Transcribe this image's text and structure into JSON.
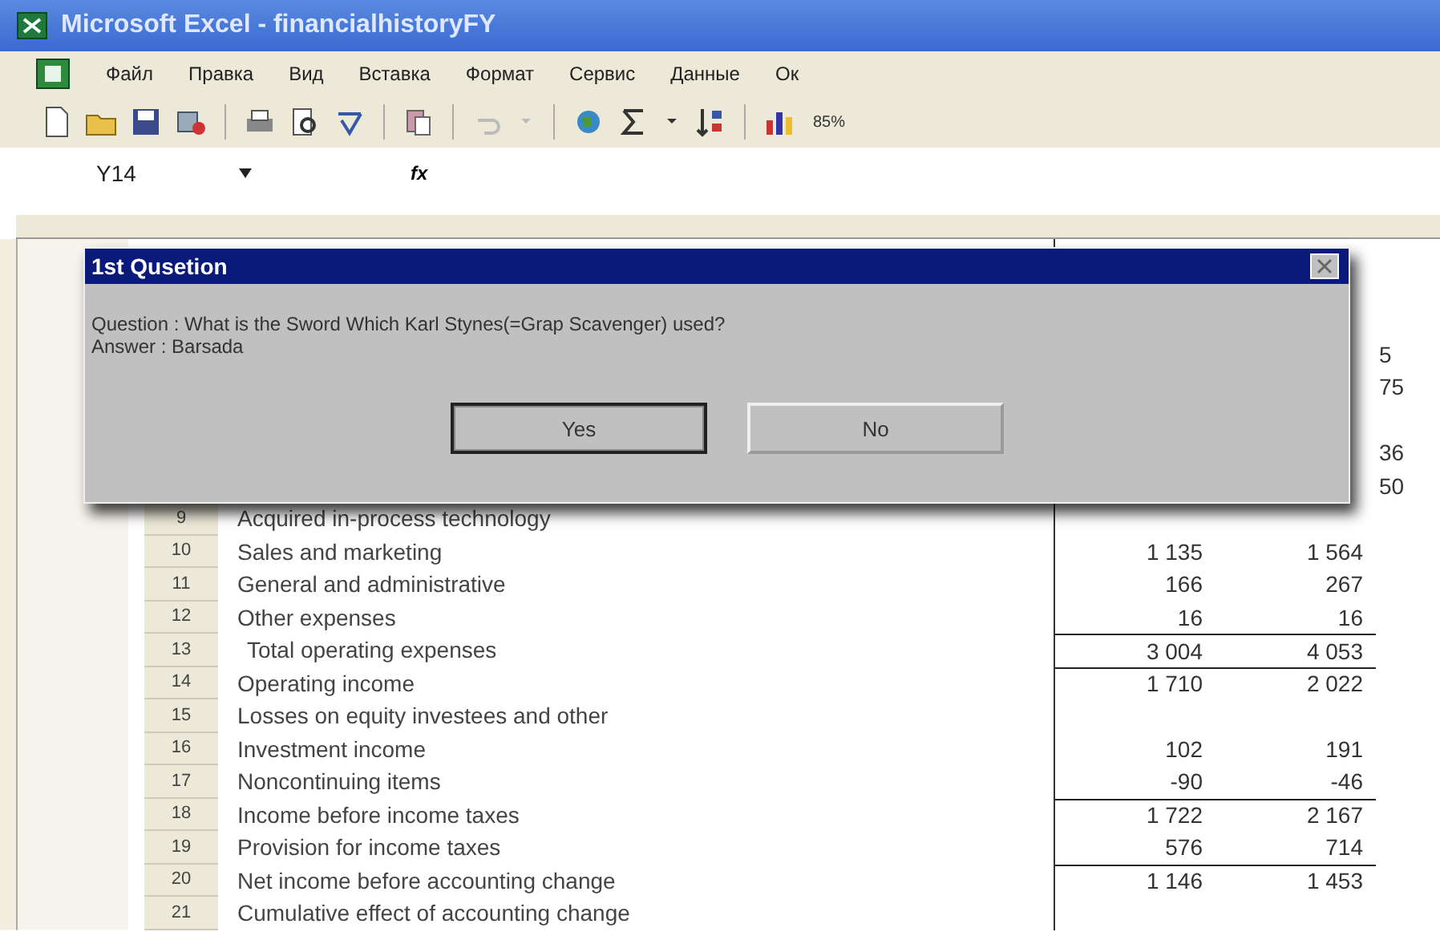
{
  "window": {
    "title": "Microsoft Excel - financialhistoryFY"
  },
  "menu": [
    "Файл",
    "Правка",
    "Вид",
    "Вставка",
    "Формат",
    "Сервис",
    "Данные",
    "Ок"
  ],
  "toolbar": {
    "zoom": "85%"
  },
  "formula_bar": {
    "name_box": "Y14",
    "function_label": "fx"
  },
  "covered_cells": [
    {
      "text": "5"
    },
    {
      "text": "75"
    },
    {
      "text": "36"
    },
    {
      "text": "50"
    }
  ],
  "rows": [
    {
      "number": "9",
      "label": "Acquired in-process technology",
      "values": [],
      "indent": false,
      "total_line": false
    },
    {
      "number": "10",
      "label": "Sales and marketing",
      "values": [
        "1 135",
        "1 564"
      ],
      "indent": false,
      "total_line": false
    },
    {
      "number": "11",
      "label": "General and administrative",
      "values": [
        "166",
        "267"
      ],
      "indent": false,
      "total_line": false
    },
    {
      "number": "12",
      "label": "Other expenses",
      "values": [
        "16",
        "16"
      ],
      "indent": false,
      "total_line": false
    },
    {
      "number": "13",
      "label": "Total operating expenses",
      "values": [
        "3 004",
        "4 053"
      ],
      "indent": true,
      "total_line": true
    },
    {
      "number": "14",
      "label": "Operating income",
      "values": [
        "1 710",
        "2 022"
      ],
      "indent": false,
      "total_line": true
    },
    {
      "number": "15",
      "label": "Losses on equity investees and other",
      "values": [],
      "indent": false,
      "total_line": false
    },
    {
      "number": "16",
      "label": "Investment income",
      "values": [
        "102",
        "191"
      ],
      "indent": false,
      "total_line": false
    },
    {
      "number": "17",
      "label": "Noncontinuing items",
      "values": [
        "-90",
        "-46"
      ],
      "indent": false,
      "total_line": false
    },
    {
      "number": "18",
      "label": "Income before income taxes",
      "values": [
        "1 722",
        "2 167"
      ],
      "indent": false,
      "total_line": true
    },
    {
      "number": "19",
      "label": "Provision for income taxes",
      "values": [
        "576",
        "714"
      ],
      "indent": false,
      "total_line": false
    },
    {
      "number": "20",
      "label": "Net income before accounting change",
      "values": [
        "1 146",
        "1 453"
      ],
      "indent": false,
      "total_line": true
    },
    {
      "number": "21",
      "label": "Cumulative effect of accounting change",
      "values": [],
      "indent": false,
      "total_line": false
    }
  ],
  "dialog": {
    "title": "1st Qusetion",
    "lines": [
      "Question : What is the Sword Which Karl Stynes(=Grap Scavenger) used?",
      "Answer : Barsada"
    ],
    "buttons": [
      {
        "label": "Yes",
        "selected": true
      },
      {
        "label": "No",
        "selected": false
      }
    ]
  }
}
